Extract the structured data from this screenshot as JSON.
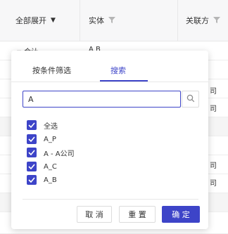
{
  "table": {
    "headers": {
      "expand_all": "全部展开",
      "entity": "实体",
      "related_party": "关联方"
    },
    "rows": {
      "total_label": "合计",
      "total_entity": "A B",
      "suffix_1": "司",
      "suffix_2": "司",
      "suffix_3": "司",
      "suffix_4": "司"
    }
  },
  "popover": {
    "tabs": [
      "按条件筛选",
      "搜索"
    ],
    "active_tab": "搜索",
    "search_value": "A",
    "options": [
      {
        "label": "全选",
        "checked": true
      },
      {
        "label": "A_P",
        "checked": true
      },
      {
        "label": "A - A公司",
        "checked": true
      },
      {
        "label": "A_C",
        "checked": true
      },
      {
        "label": "A_B",
        "checked": true
      }
    ],
    "buttons": {
      "cancel": "取 消",
      "reset": "重 置",
      "confirm": "确 定"
    }
  },
  "colors": {
    "accent": "#3d44c8",
    "header_bg": "#f7f7f8"
  }
}
